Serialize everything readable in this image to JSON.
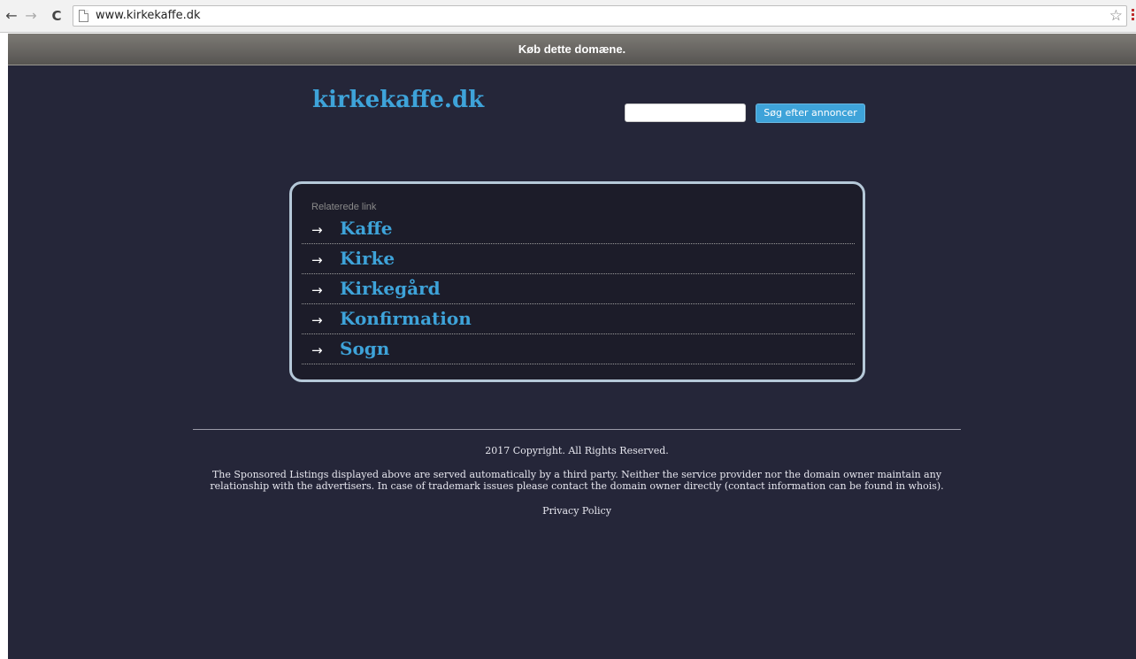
{
  "browser": {
    "back_icon": "←",
    "forward_icon": "→",
    "reload_icon": "C",
    "url": "www.kirkekaffe.dk",
    "bookmark_icon": "☆"
  },
  "banner": {
    "label": "Køb dette domæne."
  },
  "header": {
    "site_title": "kirkekaffe.dk",
    "search_placeholder": "",
    "search_button": "Søg efter annoncer"
  },
  "related": {
    "heading": "Relaterede link",
    "arrow": "→",
    "links": [
      {
        "label": "Kaffe"
      },
      {
        "label": "Kirke"
      },
      {
        "label": "Kirkegård"
      },
      {
        "label": "Konfirmation"
      },
      {
        "label": "Sogn"
      }
    ]
  },
  "footer": {
    "copyright": "2017 Copyright. All Rights Reserved.",
    "disclaimer_line1": "The Sponsored Listings displayed above are served automatically by a third party. Neither the service provider nor the domain owner maintain any",
    "disclaimer_line2": "relationship with the advertisers. In case of trademark issues please contact the domain owner directly (contact information can be found in whois).",
    "privacy": "Privacy Policy"
  },
  "colors": {
    "page_bg": "#252639",
    "accent": "#3ea3d9",
    "box_border": "#b5c8d8"
  }
}
